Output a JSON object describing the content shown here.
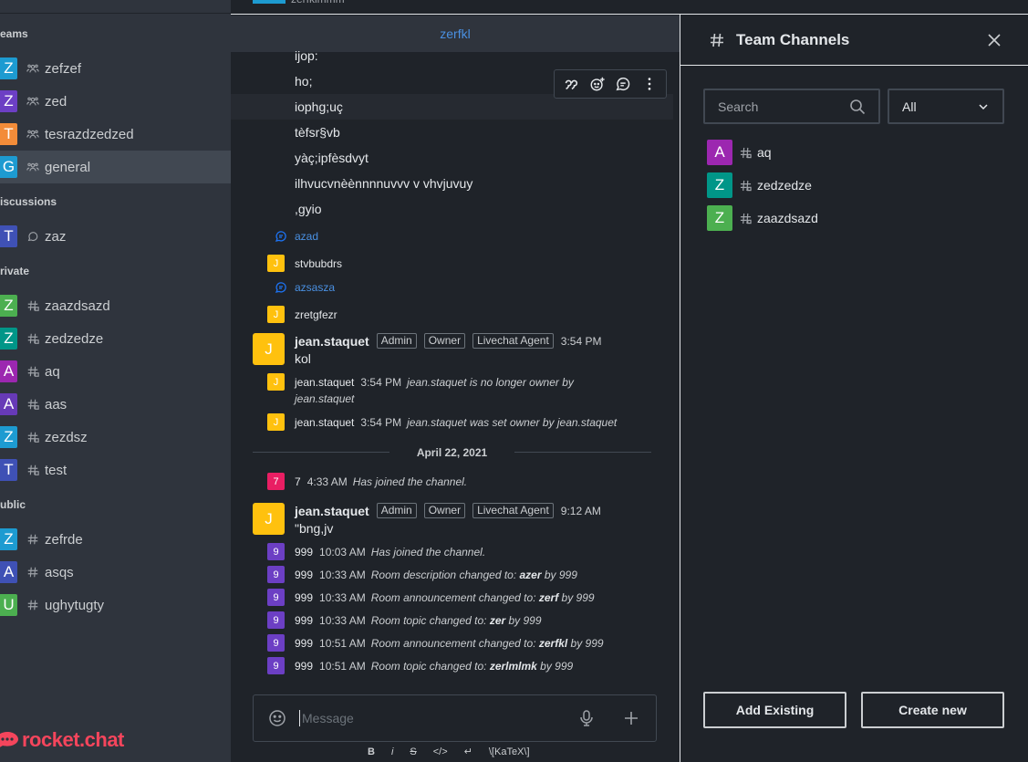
{
  "sidebar": {
    "groups": {
      "teams": "eams",
      "discussions": "iscussions",
      "private": "rivate",
      "public": "ublic"
    },
    "teams": [
      {
        "initial": "Z",
        "color": "#1d9bd1",
        "label": "zefzef"
      },
      {
        "initial": "Z",
        "color": "#6c3fc4",
        "label": "zed"
      },
      {
        "initial": "T",
        "color": "#f38c39",
        "label": "tesrazdzedzed"
      },
      {
        "initial": "G",
        "color": "#1d9bd1",
        "label": "general"
      }
    ],
    "discussions": [
      {
        "initial": "T",
        "color": "#3f51b5",
        "label": "zaz"
      }
    ],
    "private": [
      {
        "initial": "Z",
        "color": "#4caf50",
        "label": "zaazdsazd"
      },
      {
        "initial": "Z",
        "color": "#009688",
        "label": "zedzedze"
      },
      {
        "initial": "A",
        "color": "#9c27b0",
        "label": "aq"
      },
      {
        "initial": "A",
        "color": "#673ab7",
        "label": "aas"
      },
      {
        "initial": "Z",
        "color": "#1d9bd1",
        "label": "zezdsz"
      },
      {
        "initial": "T",
        "color": "#3f51b5",
        "label": "test"
      }
    ],
    "public": [
      {
        "initial": "Z",
        "color": "#1d9bd1",
        "label": "zefrde"
      },
      {
        "initial": "A",
        "color": "#3f51b5",
        "label": "asqs"
      },
      {
        "initial": "U",
        "color": "#4caf50",
        "label": "ughytugty"
      }
    ],
    "logo_text": "rocket.chat"
  },
  "main": {
    "top_text": "zerfklmmm",
    "room_name": "zerfkl",
    "plain_lines": [
      "ijop:",
      "ho;",
      "iophg;uç",
      "tèfsr§vb",
      "yàç;ipfèsdvyt",
      "ilhvucvnèènnnnuvvv v vhvjuvuy",
      ",gyio"
    ],
    "threads": [
      {
        "type": "thread",
        "text": "azad"
      },
      {
        "type": "user",
        "initial": "J",
        "text": "stvbubdrs"
      },
      {
        "type": "thread",
        "text": "azsasza"
      },
      {
        "type": "user",
        "initial": "J",
        "text": "zretgfezr"
      }
    ],
    "message1": {
      "avatar": "J",
      "user": "jean.staquet",
      "tags": [
        "Admin",
        "Owner",
        "Livechat Agent"
      ],
      "time": "3:54 PM",
      "body": "kol"
    },
    "sys_owner": [
      {
        "avatar": "J",
        "user": "jean.staquet",
        "time": "3:54 PM",
        "text": "jean.staquet is no longer owner by",
        "text2": "jean.staquet"
      },
      {
        "avatar": "J",
        "user": "jean.staquet",
        "time": "3:54 PM",
        "text": "jean.staquet was set owner by jean.staquet"
      }
    ],
    "date_divider": "April 22, 2021",
    "joined7": {
      "avatar": "7",
      "user": "7",
      "time": "4:33 AM",
      "text": "Has joined the channel."
    },
    "message2": {
      "avatar": "J",
      "user": "jean.staquet",
      "tags": [
        "Admin",
        "Owner",
        "Livechat Agent"
      ],
      "time": "9:12 AM",
      "body": "\"bng,jv"
    },
    "sys999": [
      {
        "avatar": "9",
        "user": "999",
        "time": "10:03 AM",
        "pre": "Has joined the channel.",
        "bold": "",
        "post": ""
      },
      {
        "avatar": "9",
        "user": "999",
        "time": "10:33 AM",
        "pre": "Room description changed to: ",
        "bold": "azer",
        "post": " by 999"
      },
      {
        "avatar": "9",
        "user": "999",
        "time": "10:33 AM",
        "pre": "Room announcement changed to: ",
        "bold": "zerf",
        "post": " by 999"
      },
      {
        "avatar": "9",
        "user": "999",
        "time": "10:33 AM",
        "pre": "Room topic changed to: ",
        "bold": "zer",
        "post": " by 999"
      },
      {
        "avatar": "9",
        "user": "999",
        "time": "10:51 AM",
        "pre": "Room announcement changed to: ",
        "bold": "zerfkl",
        "post": " by 999"
      },
      {
        "avatar": "9",
        "user": "999",
        "time": "10:51 AM",
        "pre": "Room topic changed to: ",
        "bold": "zerlmlmk",
        "post": " by 999"
      }
    ],
    "composer": {
      "placeholder": "Message",
      "format": [
        "B",
        "i",
        "S",
        "</>",
        "↵",
        "\\[KaTeX\\]"
      ]
    }
  },
  "panel": {
    "title": "Team Channels",
    "search_placeholder": "Search",
    "filter_value": "All",
    "channels": [
      {
        "initial": "A",
        "color": "#9c27b0",
        "label": "aq"
      },
      {
        "initial": "Z",
        "color": "#009688",
        "label": "zedzedze"
      },
      {
        "initial": "Z",
        "color": "#4caf50",
        "label": "zaazdsazd"
      }
    ],
    "add_existing": "Add Existing",
    "create_new": "Create new"
  },
  "colors": {
    "accent": "#1d74f5",
    "user_avatar": "#ffc10e",
    "sys999": "#6c3fc4",
    "sys7": "#e91e63",
    "logo": "#f5455c"
  }
}
